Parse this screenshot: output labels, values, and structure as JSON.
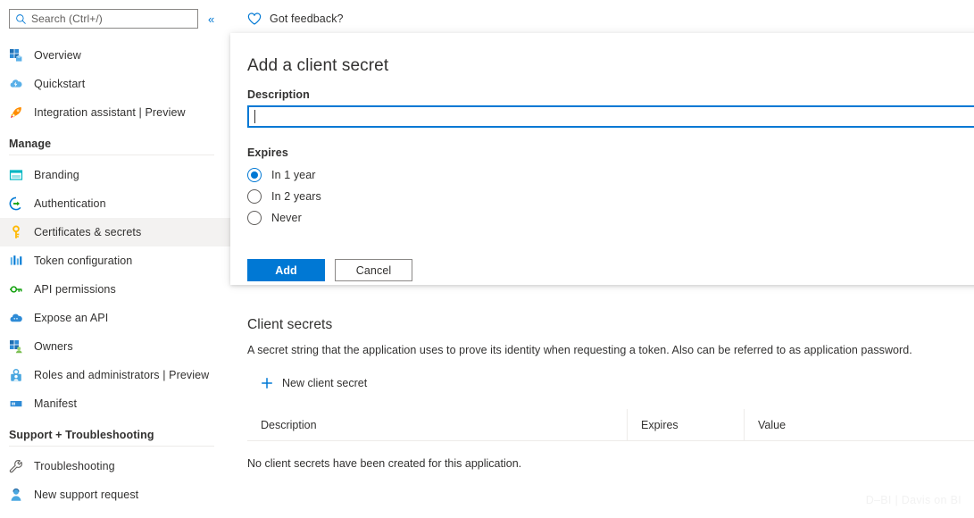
{
  "search": {
    "placeholder": "Search (Ctrl+/)",
    "collapse_glyph": "«",
    "icon": "search-icon"
  },
  "sidebar": {
    "items": [
      {
        "label": "Overview",
        "icon": "overview-grid-icon",
        "selected": false
      },
      {
        "label": "Quickstart",
        "icon": "cloud-lightning-icon",
        "selected": false
      },
      {
        "label": "Integration assistant | Preview",
        "icon": "rocket-icon",
        "selected": false
      }
    ],
    "sections": [
      {
        "title": "Manage",
        "items": [
          {
            "label": "Branding",
            "icon": "branding-banner-icon",
            "selected": false
          },
          {
            "label": "Authentication",
            "icon": "authentication-icon",
            "selected": false
          },
          {
            "label": "Certificates & secrets",
            "icon": "key-icon",
            "selected": true
          },
          {
            "label": "Token configuration",
            "icon": "token-bars-icon",
            "selected": false
          },
          {
            "label": "API permissions",
            "icon": "api-permissions-icon",
            "selected": false
          },
          {
            "label": "Expose an API",
            "icon": "expose-api-cloud-icon",
            "selected": false
          },
          {
            "label": "Owners",
            "icon": "owners-icon",
            "selected": false
          },
          {
            "label": "Roles and administrators | Preview",
            "icon": "roles-person-icon",
            "selected": false
          },
          {
            "label": "Manifest",
            "icon": "manifest-doc-icon",
            "selected": false
          }
        ]
      },
      {
        "title": "Support + Troubleshooting",
        "items": [
          {
            "label": "Troubleshooting",
            "icon": "wrench-icon",
            "selected": false
          },
          {
            "label": "New support request",
            "icon": "support-person-icon",
            "selected": false
          }
        ]
      }
    ]
  },
  "header": {
    "feedback_label": "Got feedback?",
    "feedback_icon": "heart-icon"
  },
  "dialog": {
    "title": "Add a client secret",
    "description_label": "Description",
    "description_value": "",
    "expires_label": "Expires",
    "expires_options": [
      {
        "label": "In 1 year",
        "selected": true
      },
      {
        "label": "In 2 years",
        "selected": false
      },
      {
        "label": "Never",
        "selected": false
      }
    ],
    "add_label": "Add",
    "cancel_label": "Cancel"
  },
  "client_secrets": {
    "title": "Client secrets",
    "description": "A secret string that the application uses to prove its identity when requesting a token. Also can be referred to as application password.",
    "new_secret_label": "New client secret",
    "new_secret_icon": "plus-icon",
    "columns": [
      "Description",
      "Expires",
      "Value"
    ],
    "rows": [],
    "empty_message": "No client secrets have been created for this application."
  },
  "watermark": "D–BI | Davis on BI",
  "colors": {
    "accent": "#0078d4",
    "text": "#323130",
    "subtle_text": "#605e5c",
    "selected_bg": "#f3f2f1",
    "border": "#edebe9",
    "key_gold": "#ffb900",
    "green": "#13a10e",
    "cyan": "#00b7c3"
  }
}
